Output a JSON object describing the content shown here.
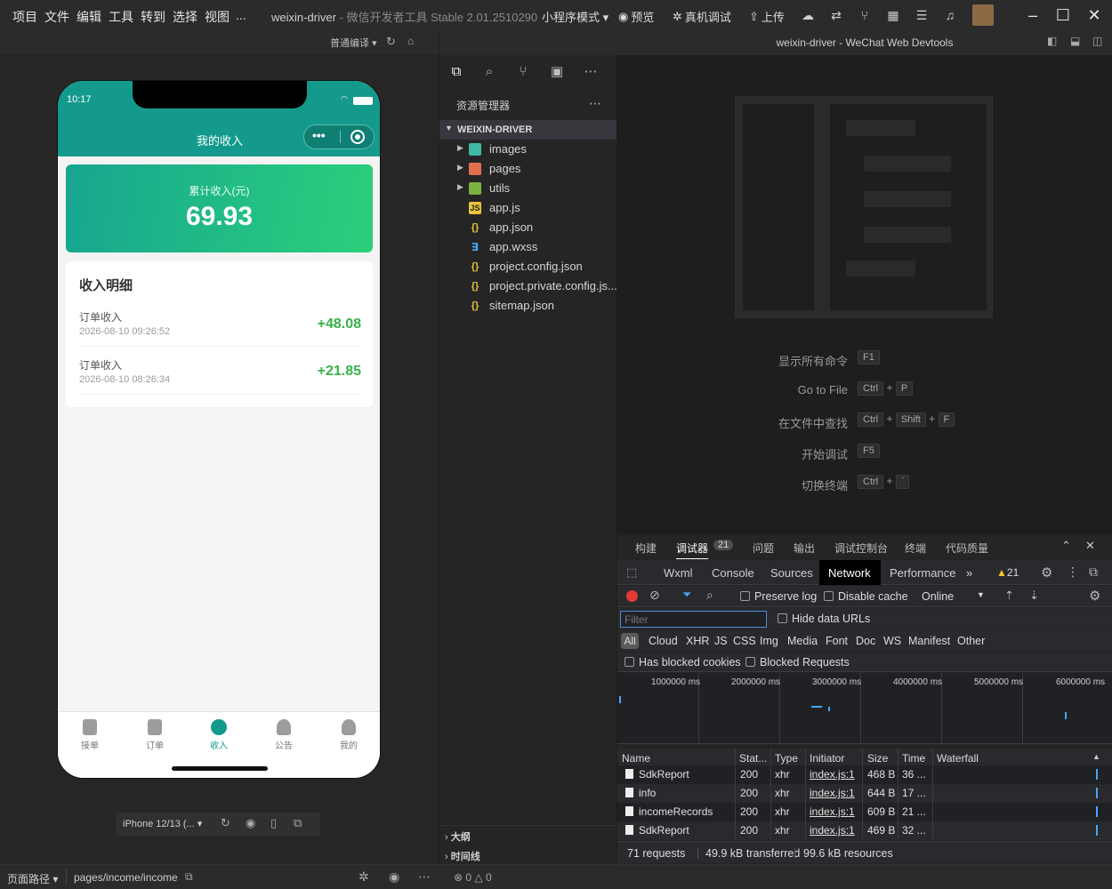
{
  "menu": [
    "项目",
    "文件",
    "编辑",
    "工具",
    "转到",
    "选择",
    "视图",
    "..."
  ],
  "app_title": {
    "main": "weixin-driver",
    "sub": " - 微信开发者工具 Stable 2.01.2510290"
  },
  "toolbar": {
    "mode": "小程序模式 ▾",
    "preview": "预览",
    "real_debug": "真机调试",
    "upload": "上传"
  },
  "sim_toolbar": {
    "compile_mode": "普通编译 ▾"
  },
  "editor_title": "weixin-driver - WeChat Web Devtools",
  "phone": {
    "time": "10:17",
    "nav_title": "我的收入",
    "total_label": "累计收入(元)",
    "total_value": "69.93",
    "detail_title": "收入明细",
    "records": [
      {
        "title": "订单收入",
        "time": "2026-08-10 09:26:52",
        "amount": "+48.08"
      },
      {
        "title": "订单收入",
        "time": "2026-08-10 08:26:34",
        "amount": "+21.85"
      }
    ],
    "tabs": [
      {
        "label": "接单",
        "icon": "clipboard-icon"
      },
      {
        "label": "订单",
        "icon": "list-icon"
      },
      {
        "label": "收入",
        "icon": "income-icon",
        "active": true
      },
      {
        "label": "公告",
        "icon": "bulb-icon"
      },
      {
        "label": "我的",
        "icon": "user-icon"
      }
    ],
    "active_color": "#139a8c"
  },
  "device_select": "iPhone 12/13 (... ▾",
  "explorer": {
    "title": "资源管理器",
    "root": "WEIXIN-DRIVER",
    "items": [
      {
        "name": "images",
        "type": "folder"
      },
      {
        "name": "pages",
        "type": "folder"
      },
      {
        "name": "utils",
        "type": "folder"
      },
      {
        "name": "app.js",
        "type": "js"
      },
      {
        "name": "app.json",
        "type": "json"
      },
      {
        "name": "app.wxss",
        "type": "wxss"
      },
      {
        "name": "project.config.json",
        "type": "json"
      },
      {
        "name": "project.private.config.js...",
        "type": "json"
      },
      {
        "name": "sitemap.json",
        "type": "json"
      }
    ],
    "outline": "大纲",
    "timeline": "时间线"
  },
  "commands": [
    {
      "label": "显示所有命令",
      "keys": [
        "F1"
      ]
    },
    {
      "label": "Go to File",
      "keys": [
        "Ctrl",
        "+",
        "P"
      ]
    },
    {
      "label": "在文件中查找",
      "keys": [
        "Ctrl",
        "+",
        "Shift",
        "+",
        "F"
      ]
    },
    {
      "label": "开始调试",
      "keys": [
        "F5"
      ]
    },
    {
      "label": "切换终端",
      "keys": [
        "Ctrl",
        "+",
        "`"
      ]
    }
  ],
  "panel_tabs": [
    "构建",
    "调试器",
    "问题",
    "输出",
    "调试控制台",
    "终端",
    "代码质量"
  ],
  "debugger_badge": "21",
  "devtools_tabs": [
    "Wxml",
    "Console",
    "Sources",
    "Network",
    "Performance"
  ],
  "warn_count": "21",
  "network": {
    "preserve_log": "Preserve log",
    "disable_cache": "Disable cache",
    "throttle": "Online",
    "filter_placeholder": "Filter",
    "hide_data_urls": "Hide data URLs",
    "types": [
      "All",
      "Cloud",
      "XHR",
      "JS",
      "CSS",
      "Img",
      "Media",
      "Font",
      "Doc",
      "WS",
      "Manifest",
      "Other"
    ],
    "has_blocked": "Has blocked cookies",
    "blocked_requests": "Blocked Requests",
    "timeline_labels": [
      "1000000 ms",
      "2000000 ms",
      "3000000 ms",
      "4000000 ms",
      "5000000 ms",
      "6000000 ms"
    ],
    "columns": [
      "Name",
      "Stat...",
      "Type",
      "Initiator",
      "Size",
      "Time",
      "Waterfall"
    ],
    "rows": [
      {
        "name": "SdkReport",
        "status": "200",
        "type": "xhr",
        "initiator": "index.js:1",
        "size": "468 B",
        "time": "36 ..."
      },
      {
        "name": "info",
        "status": "200",
        "type": "xhr",
        "initiator": "index.js:1",
        "size": "644 B",
        "time": "17 ..."
      },
      {
        "name": "incomeRecords",
        "status": "200",
        "type": "xhr",
        "initiator": "index.js:1",
        "size": "609 B",
        "time": "21 ..."
      },
      {
        "name": "SdkReport",
        "status": "200",
        "type": "xhr",
        "initiator": "index.js:1",
        "size": "469 B",
        "time": "32 ..."
      }
    ],
    "summary": {
      "requests": "71 requests",
      "transferred": "49.9 kB transferred",
      "resources": "99.6 kB resources"
    }
  },
  "statusbar": {
    "page_path_label": "页面路径 ▾",
    "page_path": "pages/income/income",
    "errors": "0",
    "warnings": "0"
  }
}
